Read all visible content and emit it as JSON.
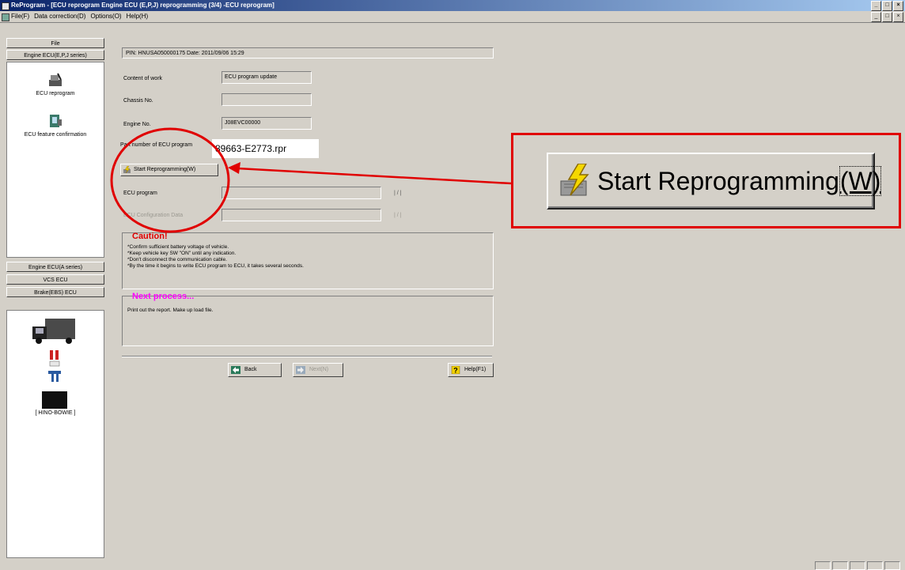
{
  "window": {
    "title": "ReProgram - [ECU reprogram Engine ECU (E,P,J) reprogramming (3/4) -ECU reprogram]",
    "controls": [
      "_",
      "□",
      "×"
    ]
  },
  "menu": {
    "items": [
      "File(F)",
      "Data correction(D)",
      "Options(O)",
      "Help(H)"
    ]
  },
  "sidebar": {
    "file_label": "File",
    "group_top": "Engine ECU(E,P,J series)",
    "items": [
      {
        "label": "ECU reprogram",
        "icon": "ecu-reprogram-icon"
      },
      {
        "label": "ECU feature confirmation",
        "icon": "ecu-feature-icon"
      }
    ],
    "group_bottom": [
      "Engine ECU(A series)",
      "VCS ECU",
      "Brake(EBS) ECU"
    ],
    "device_label": "[ HINO-BOWIE ]"
  },
  "main": {
    "pin_date": "PIN: HNUSA050000175  Date: 2011/09/06 15:29",
    "content_label": "Content of work",
    "content_value": "ECU program update",
    "chassis_label": "Chassis No.",
    "chassis_value": "",
    "engine_label": "Engine No.",
    "engine_value": "J08EVC00000",
    "part_label": "Part number of ECU program",
    "part_value": "89663-E2773.rpr",
    "start_button": "Start Reprogramming(W)",
    "ecu_program_label": "ECU program",
    "ecu_program_counter": "|    /    |",
    "ecu_config_label": "ECU Configuration Data",
    "ecu_config_counter": "|    /    |",
    "caution_title": "Caution!",
    "caution_lines": [
      "*Confirm sufficient battery voltage of vehicle.",
      "*Keep vehicle key SW \"ON\" until any indication.",
      "*Don't disconnect the communication cable.",
      "*By the time it begins to write ECU program to ECU, it takes several seconds."
    ],
    "next_title": "Next process...",
    "next_text": "Print out the report. Make up load file.",
    "back_button": "Back",
    "next_button": "Next(N)",
    "help_button": "Help(F1)"
  },
  "callout": {
    "zoom_label_main": "Start Reprogramming",
    "zoom_label_key": "(W)"
  },
  "colors": {
    "window_bg": "#d4d0c8",
    "caution": "#e00000",
    "next_process": "#ff00ff",
    "annotation": "#e00000"
  }
}
